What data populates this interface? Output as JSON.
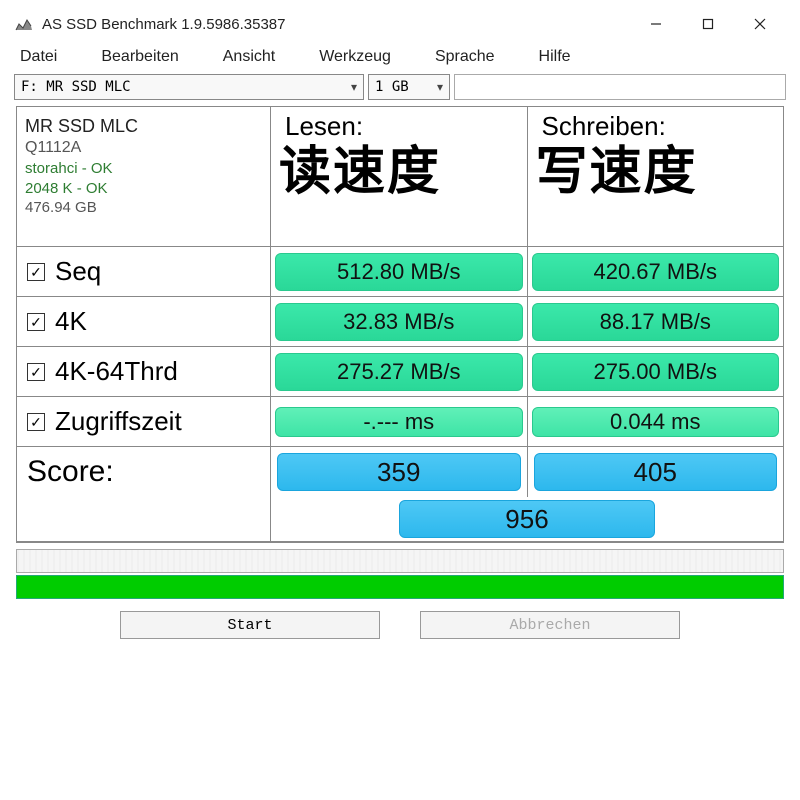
{
  "titlebar": {
    "title": "AS SSD Benchmark 1.9.5986.35387"
  },
  "menu": {
    "datei": "Datei",
    "bearbeiten": "Bearbeiten",
    "ansicht": "Ansicht",
    "werkzeug": "Werkzeug",
    "sprache": "Sprache",
    "hilfe": "Hilfe"
  },
  "toolbar": {
    "drive": "F: MR SSD MLC",
    "size": "1 GB"
  },
  "device": {
    "name": "MR SSD MLC",
    "sub": "Q1112A",
    "status1": "storahci - OK",
    "status2": "2048 K - OK",
    "capacity": "476.94 GB"
  },
  "headers": {
    "read": "Lesen:",
    "write": "Schreiben:",
    "read_cn": "读速度",
    "write_cn": "写速度"
  },
  "rows": {
    "seq": {
      "label": "Seq",
      "read": "512.80 MB/s",
      "write": "420.67 MB/s"
    },
    "k4": {
      "label": "4K",
      "read": "32.83 MB/s",
      "write": "88.17 MB/s"
    },
    "k4t": {
      "label": "4K-64Thrd",
      "read": "275.27 MB/s",
      "write": "275.00 MB/s"
    },
    "acc": {
      "label": "Zugriffszeit",
      "read": "-.--- ms",
      "write": "0.044 ms"
    }
  },
  "score": {
    "label": "Score:",
    "read": "359",
    "write": "405",
    "total": "956"
  },
  "buttons": {
    "start": "Start",
    "cancel": "Abbrechen"
  }
}
